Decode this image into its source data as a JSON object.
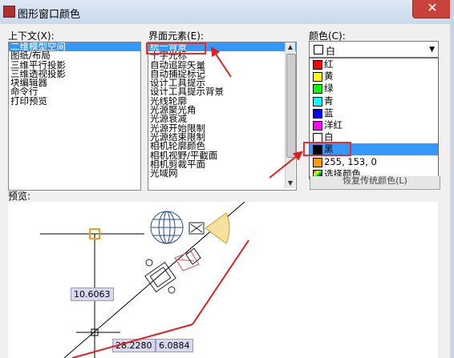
{
  "window": {
    "title": "图形窗口颜色",
    "close_label": "✕"
  },
  "context": {
    "label": "上下文(X):",
    "items": [
      "二维模型空间",
      "图纸/布局",
      "三维平行投影",
      "三维透视投影",
      "块编辑器",
      "命令行",
      "打印预览"
    ],
    "selected_index": 0
  },
  "elements": {
    "label": "界面元素(E):",
    "items": [
      "统一背景",
      "十字光标",
      "自动追踪矢量",
      "自动捕捉标记",
      "设计工具提示",
      "设计工具提示背景",
      "光线轮廓",
      "光源聚光角",
      "光源衰减",
      "光源开始限制",
      "光源结束限制",
      "相机轮廓颜色",
      "相机视野/平截面",
      "相机剪裁平面",
      "光域网"
    ],
    "selected_index": 0
  },
  "color": {
    "label": "颜色(C):",
    "current_value": "白",
    "current_swatch": "#ffffff",
    "options": [
      {
        "label": "红",
        "swatch": "#ff0000"
      },
      {
        "label": "黄",
        "swatch": "#ffff00"
      },
      {
        "label": "绿",
        "swatch": "#00ff00"
      },
      {
        "label": "青",
        "swatch": "#00ffff"
      },
      {
        "label": "蓝",
        "swatch": "#0000ff"
      },
      {
        "label": "洋红",
        "swatch": "#ff00ff"
      },
      {
        "label": "白",
        "swatch": "#ffffff"
      },
      {
        "label": "黑",
        "swatch": "#000000"
      },
      {
        "label": "255, 153, 0",
        "swatch": "#ff9900"
      },
      {
        "label": "选择颜色...",
        "swatch": "multi"
      }
    ],
    "selected_index": 7,
    "restore_button_label": "恢复传统颜色(L)"
  },
  "preview": {
    "label": "预览:",
    "dimensions": [
      "10.6063",
      "28.2280",
      "6.0884"
    ]
  },
  "annotation_color": "#e02020"
}
